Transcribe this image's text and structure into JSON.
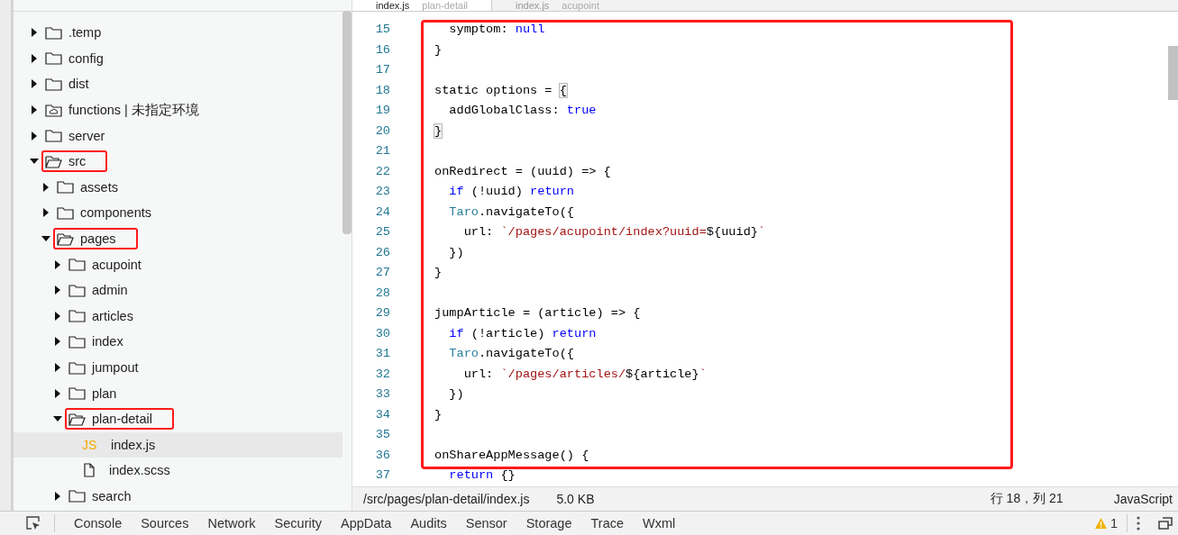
{
  "editor_tabs": [
    {
      "label": "index.js",
      "hint": "plan-detail",
      "selected": true
    },
    {
      "label": "index.js",
      "hint": "acupoint",
      "selected": false
    }
  ],
  "tree": [
    {
      "kind": "folder",
      "name": ".temp",
      "expanded": false,
      "highlighted": false,
      "selected": false
    },
    {
      "kind": "folder",
      "name": "config",
      "expanded": false,
      "highlighted": false,
      "selected": false
    },
    {
      "kind": "folder",
      "name": "dist",
      "expanded": false,
      "highlighted": false,
      "selected": false
    },
    {
      "kind": "cloud-folder",
      "name": "functions | 未指定环境",
      "expanded": false,
      "highlighted": false,
      "selected": false
    },
    {
      "kind": "folder",
      "name": "server",
      "expanded": false,
      "highlighted": false,
      "selected": false
    },
    {
      "kind": "folder",
      "name": "src",
      "expanded": true,
      "highlighted": true,
      "selected": false,
      "children": [
        {
          "kind": "folder",
          "name": "assets",
          "expanded": false,
          "highlighted": false,
          "selected": false
        },
        {
          "kind": "folder",
          "name": "components",
          "expanded": false,
          "highlighted": false,
          "selected": false
        },
        {
          "kind": "folder",
          "name": "pages",
          "expanded": true,
          "highlighted": true,
          "selected": false,
          "children": [
            {
              "kind": "folder",
              "name": "acupoint",
              "expanded": false,
              "highlighted": false,
              "selected": false
            },
            {
              "kind": "folder",
              "name": "admin",
              "expanded": false,
              "highlighted": false,
              "selected": false
            },
            {
              "kind": "folder",
              "name": "articles",
              "expanded": false,
              "highlighted": false,
              "selected": false
            },
            {
              "kind": "folder",
              "name": "index",
              "expanded": false,
              "highlighted": false,
              "selected": false
            },
            {
              "kind": "folder",
              "name": "jumpout",
              "expanded": false,
              "highlighted": false,
              "selected": false
            },
            {
              "kind": "folder",
              "name": "plan",
              "expanded": false,
              "highlighted": false,
              "selected": false
            },
            {
              "kind": "folder",
              "name": "plan-detail",
              "expanded": true,
              "highlighted": true,
              "selected": false,
              "children": [
                {
                  "kind": "js",
                  "name": "index.js",
                  "badge": "JS",
                  "highlighted": false,
                  "selected": true
                },
                {
                  "kind": "file",
                  "name": "index.scss",
                  "highlighted": false,
                  "selected": false
                }
              ]
            },
            {
              "kind": "folder",
              "name": "search",
              "expanded": false,
              "highlighted": false,
              "selected": false
            }
          ]
        }
      ]
    }
  ],
  "editor": {
    "highlight_box": true,
    "lines": [
      {
        "number": "15",
        "tokens": [
          {
            "text": "  symptom: ",
            "kind": "plain"
          },
          {
            "text": "null",
            "kind": "constant"
          }
        ]
      },
      {
        "number": "16",
        "tokens": [
          {
            "text": "}",
            "kind": "plain"
          }
        ]
      },
      {
        "number": "17"
      },
      {
        "number": "18",
        "tokens": [
          {
            "text": "static options = ",
            "kind": "plain"
          },
          {
            "text": "{",
            "kind": "match"
          }
        ]
      },
      {
        "number": "19",
        "tokens": [
          {
            "text": "  addGlobalClass: ",
            "kind": "plain"
          },
          {
            "text": "true",
            "kind": "constant"
          }
        ]
      },
      {
        "number": "20",
        "tokens": [
          {
            "text": "}",
            "kind": "match"
          }
        ]
      },
      {
        "number": "21"
      },
      {
        "number": "22",
        "tokens": [
          {
            "text": "onRedirect = (uuid) => {",
            "kind": "plain"
          }
        ]
      },
      {
        "number": "23",
        "tokens": [
          {
            "text": "  if",
            "kind": "keyword"
          },
          {
            "text": " (!uuid) ",
            "kind": "plain"
          },
          {
            "text": "return",
            "kind": "keyword"
          }
        ]
      },
      {
        "number": "24",
        "tokens": [
          {
            "text": "  Taro",
            "kind": "type"
          },
          {
            "text": ".navigateTo({",
            "kind": "plain"
          }
        ]
      },
      {
        "number": "25",
        "tokens": [
          {
            "text": "    url: ",
            "kind": "plain"
          },
          {
            "text": "`/pages/acupoint/index?uuid=",
            "kind": "string"
          },
          {
            "text": "${uuid}",
            "kind": "plain"
          },
          {
            "text": "`",
            "kind": "string"
          }
        ]
      },
      {
        "number": "26",
        "tokens": [
          {
            "text": "  })",
            "kind": "plain"
          }
        ]
      },
      {
        "number": "27",
        "tokens": [
          {
            "text": "}",
            "kind": "plain"
          }
        ]
      },
      {
        "number": "28"
      },
      {
        "number": "29",
        "tokens": [
          {
            "text": "jumpArticle = (article) => {",
            "kind": "plain"
          }
        ]
      },
      {
        "number": "30",
        "tokens": [
          {
            "text": "  if",
            "kind": "keyword"
          },
          {
            "text": " (!article) ",
            "kind": "plain"
          },
          {
            "text": "return",
            "kind": "keyword"
          }
        ]
      },
      {
        "number": "31",
        "tokens": [
          {
            "text": "  Taro",
            "kind": "type"
          },
          {
            "text": ".navigateTo({",
            "kind": "plain"
          }
        ]
      },
      {
        "number": "32",
        "tokens": [
          {
            "text": "    url: ",
            "kind": "plain"
          },
          {
            "text": "`/pages/articles/",
            "kind": "string"
          },
          {
            "text": "${article}",
            "kind": "plain"
          },
          {
            "text": "`",
            "kind": "string"
          }
        ]
      },
      {
        "number": "33",
        "tokens": [
          {
            "text": "  })",
            "kind": "plain"
          }
        ]
      },
      {
        "number": "34",
        "tokens": [
          {
            "text": "}",
            "kind": "plain"
          }
        ]
      },
      {
        "number": "35"
      },
      {
        "number": "36",
        "tokens": [
          {
            "text": "onShareAppMessage() {",
            "kind": "plain"
          }
        ]
      },
      {
        "number": "37",
        "tokens": [
          {
            "text": "  return",
            "kind": "keyword"
          },
          {
            "text": " {}",
            "kind": "plain"
          }
        ]
      }
    ]
  },
  "status_bar": {
    "path": "/src/pages/plan-detail/index.js",
    "size": "5.0 KB",
    "position": "行 18，列 21",
    "language": "JavaScript"
  },
  "devtools_tabs": [
    {
      "label": "Console",
      "selected": false
    },
    {
      "label": "Sources",
      "selected": false
    },
    {
      "label": "Network",
      "selected": false
    },
    {
      "label": "Security",
      "selected": false
    },
    {
      "label": "AppData",
      "selected": false
    },
    {
      "label": "Audits",
      "selected": false
    },
    {
      "label": "Sensor",
      "selected": false
    },
    {
      "label": "Storage",
      "selected": false
    },
    {
      "label": "Trace",
      "selected": false
    },
    {
      "label": "Wxml",
      "selected": false
    }
  ],
  "warnings": "1"
}
